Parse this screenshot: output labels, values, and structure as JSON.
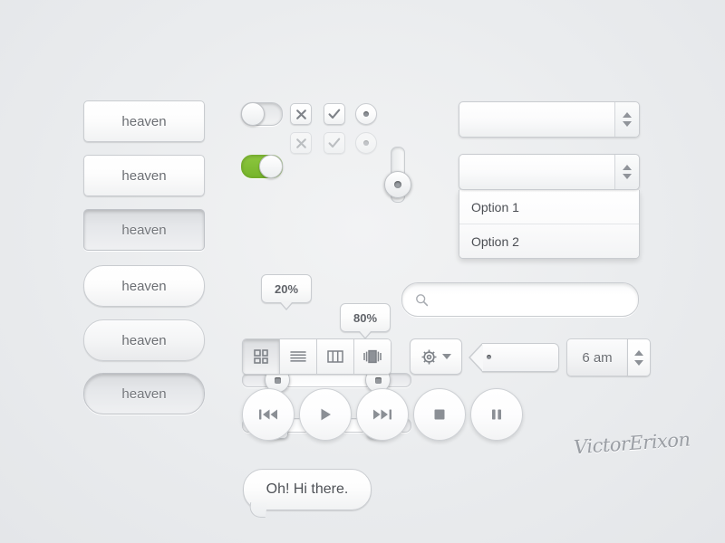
{
  "kit": {
    "signature": "VictorErixon"
  },
  "buttons": [
    {
      "label": "heaven",
      "shape": "rect",
      "state": "normal"
    },
    {
      "label": "heaven",
      "shape": "rect",
      "state": "normal"
    },
    {
      "label": "heaven",
      "shape": "rect",
      "state": "pressed"
    },
    {
      "label": "heaven",
      "shape": "pill",
      "state": "normal"
    },
    {
      "label": "heaven",
      "shape": "pill",
      "state": "normal"
    },
    {
      "label": "heaven",
      "shape": "pill",
      "state": "pressed"
    }
  ],
  "toggles": [
    {
      "name": "toggle-off",
      "state": "off",
      "track_color": "#e2e4e6"
    },
    {
      "name": "toggle-on",
      "state": "on",
      "track_color": "#8cc63e"
    }
  ],
  "checkboxes": [
    {
      "glyph": "x",
      "state": "normal"
    },
    {
      "glyph": "check",
      "state": "normal"
    },
    {
      "glyph": "x",
      "state": "disabled"
    },
    {
      "glyph": "check",
      "state": "disabled"
    }
  ],
  "radios": [
    {
      "state": "selected"
    },
    {
      "state": "disabled"
    }
  ],
  "vertical_slider": {
    "value_label": "",
    "knob_position": "55%"
  },
  "tooltips": [
    {
      "text": "20%"
    },
    {
      "text": "80%"
    }
  ],
  "sliders": [
    {
      "name": "range-slider-round",
      "handle_style": "round",
      "low": 20,
      "high": 80
    },
    {
      "name": "range-slider-grip",
      "handle_style": "grip",
      "low": 20,
      "high": 80
    }
  ],
  "bubble": {
    "text": "Oh! Hi there."
  },
  "search": {
    "value": "",
    "placeholder": "",
    "icon": "search-icon"
  },
  "segmented": {
    "items": [
      {
        "icon": "grid-view-icon",
        "active": true
      },
      {
        "icon": "list-view-icon",
        "active": false
      },
      {
        "icon": "column-view-icon",
        "active": false
      },
      {
        "icon": "coverflow-view-icon",
        "active": false
      }
    ]
  },
  "gear_button": {
    "icon": "gear-icon",
    "caret": "chevron-down-icon"
  },
  "tag": {
    "label": "",
    "icon": "tag-hole-icon"
  },
  "time_stepper": {
    "value": "6 am",
    "up": "stepper-up-icon",
    "down": "stepper-down-icon"
  },
  "media_controls": [
    {
      "name": "previous-button",
      "icon": "skip-back-icon"
    },
    {
      "name": "play-button",
      "icon": "play-icon"
    },
    {
      "name": "next-button",
      "icon": "skip-forward-icon"
    },
    {
      "name": "stop-button",
      "icon": "stop-icon"
    },
    {
      "name": "pause-button",
      "icon": "pause-icon"
    }
  ],
  "selects": [
    {
      "name": "select-closed",
      "value": "",
      "open": false,
      "options": []
    },
    {
      "name": "select-open",
      "value": "",
      "open": true,
      "options": [
        {
          "label": "Option 1"
        },
        {
          "label": "Option 2"
        }
      ]
    }
  ],
  "colors": {
    "background": "#eceef0",
    "accent_green": "#8cc63e",
    "text": "#6b6e73",
    "border": "#c9ccd0"
  }
}
